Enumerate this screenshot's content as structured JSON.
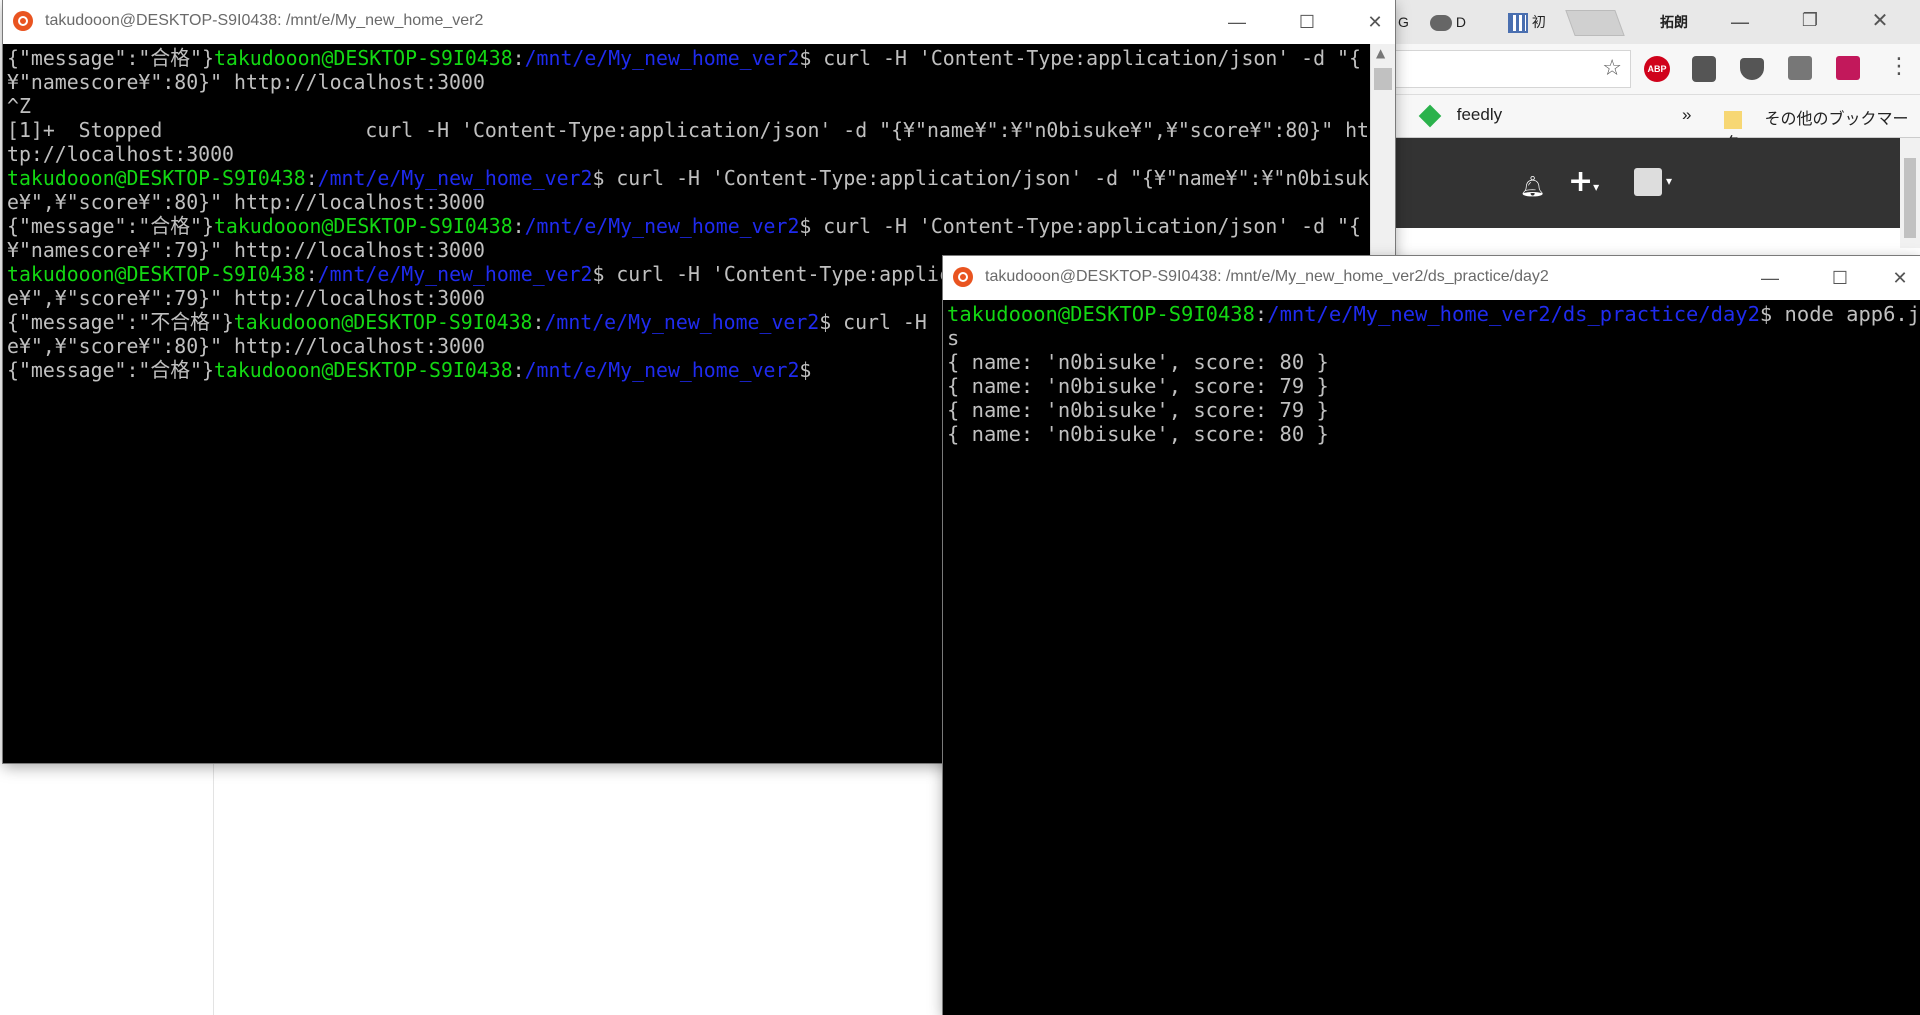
{
  "browser": {
    "tabs": [
      {
        "label": "G"
      },
      {
        "label": "D"
      },
      {
        "label": "初"
      }
    ],
    "profile_name": "拓朗",
    "bookmarks": {
      "feedly": "feedly",
      "overflow": "»",
      "other": "その他のブックマーク"
    },
    "extensions": [
      "ABP"
    ]
  },
  "terminal_main": {
    "title": "takudooon@DESKTOP-S9I0438: /mnt/e/My_new_home_ver2",
    "lines": [
      [
        {
          "t": "{\"message\":\"合格\"}",
          "c": ""
        },
        {
          "t": "takudooon@DESKTOP-S9I0438",
          "c": "g"
        },
        {
          "t": ":",
          "c": ""
        },
        {
          "t": "/mnt/e/My_new_home_ver2",
          "c": "b"
        },
        {
          "t": "$ curl -H 'Content-Type:application/json' -d \"{",
          "c": ""
        }
      ],
      [
        {
          "t": "¥\"namescore¥\":80}\" http://localhost:3000",
          "c": ""
        }
      ],
      [
        {
          "t": "^Z",
          "c": ""
        }
      ],
      [
        {
          "t": "[1]+  Stopped                 curl -H 'Content-Type:application/json' -d \"{¥\"name¥\":¥\"n0bisuke¥\",¥\"score¥\":80}\" ht",
          "c": ""
        }
      ],
      [
        {
          "t": "tp://localhost:3000",
          "c": ""
        }
      ],
      [
        {
          "t": "takudooon@DESKTOP-S9I0438",
          "c": "g"
        },
        {
          "t": ":",
          "c": ""
        },
        {
          "t": "/mnt/e/My_new_home_ver2",
          "c": "b"
        },
        {
          "t": "$ curl -H 'Content-Type:application/json' -d \"{¥\"name¥\":¥\"n0bisuk",
          "c": ""
        }
      ],
      [
        {
          "t": "e¥\",¥\"score¥\":80}\" http://localhost:3000",
          "c": ""
        }
      ],
      [
        {
          "t": "{\"message\":\"合格\"}",
          "c": ""
        },
        {
          "t": "takudooon@DESKTOP-S9I0438",
          "c": "g"
        },
        {
          "t": ":",
          "c": ""
        },
        {
          "t": "/mnt/e/My_new_home_ver2",
          "c": "b"
        },
        {
          "t": "$ curl -H 'Content-Type:application/json' -d \"{",
          "c": ""
        }
      ],
      [
        {
          "t": "¥\"namescore¥\":79}\" http://localhost:3000",
          "c": ""
        }
      ],
      [
        {
          "t": "takudooon@DESKTOP-S9I0438",
          "c": "g"
        },
        {
          "t": ":",
          "c": ""
        },
        {
          "t": "/mnt/e/My_new_home_ver2",
          "c": "b"
        },
        {
          "t": "$ curl -H 'Content-Type:applic",
          "c": ""
        }
      ],
      [
        {
          "t": "e¥\",¥\"score¥\":79}\" http://localhost:3000",
          "c": ""
        }
      ],
      [
        {
          "t": "{\"message\":\"不合格\"}",
          "c": ""
        },
        {
          "t": "takudooon@DESKTOP-S9I0438",
          "c": "g"
        },
        {
          "t": ":",
          "c": ""
        },
        {
          "t": "/mnt/e/My_new_home_ver2",
          "c": "b"
        },
        {
          "t": "$ curl -H",
          "c": ""
        }
      ],
      [
        {
          "t": "e¥\",¥\"score¥\":80}\" http://localhost:3000",
          "c": ""
        }
      ],
      [
        {
          "t": "{\"message\":\"合格\"}",
          "c": ""
        },
        {
          "t": "takudooon@DESKTOP-S9I0438",
          "c": "g"
        },
        {
          "t": ":",
          "c": ""
        },
        {
          "t": "/mnt/e/My_new_home_ver2",
          "c": "b"
        },
        {
          "t": "$",
          "c": ""
        }
      ]
    ]
  },
  "terminal_second": {
    "title": "takudooon@DESKTOP-S9I0438: /mnt/e/My_new_home_ver2/ds_practice/day2",
    "lines": [
      [
        {
          "t": "takudooon@DESKTOP-S9I0438",
          "c": "g"
        },
        {
          "t": ":",
          "c": ""
        },
        {
          "t": "/mnt/e/My_new_home_ver2/ds_practice/day2",
          "c": "b"
        },
        {
          "t": "$ node app6.j",
          "c": ""
        }
      ],
      [
        {
          "t": "s",
          "c": ""
        }
      ],
      [
        {
          "t": "{ name: 'n0bisuke', score: 80 }",
          "c": ""
        }
      ],
      [
        {
          "t": "{ name: 'n0bisuke', score: 79 }",
          "c": ""
        }
      ],
      [
        {
          "t": "{ name: 'n0bisuke', score: 79 }",
          "c": ""
        }
      ],
      [
        {
          "t": "{ name: 'n0bisuke', score: 80 }",
          "c": ""
        }
      ]
    ]
  },
  "colors": {
    "prompt_user": "#13d813",
    "prompt_path": "#1f2bef",
    "terminal_text": "#c0c0c0",
    "terminal_bg": "#000000",
    "ubuntu_orange": "#e95420"
  }
}
